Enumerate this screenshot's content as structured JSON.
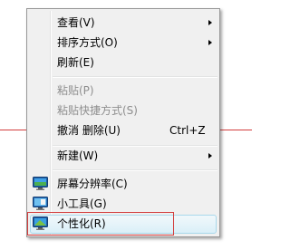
{
  "menu": {
    "view": {
      "label": "查看(V)",
      "has_submenu": true
    },
    "sort": {
      "label": "排序方式(O)",
      "has_submenu": true
    },
    "refresh": {
      "label": "刷新(E)"
    },
    "paste": {
      "label": "粘贴(P)",
      "disabled": true
    },
    "paste_shortcut": {
      "label": "粘贴快捷方式(S)",
      "disabled": true
    },
    "undo_delete": {
      "label": "撤消 删除(U)",
      "shortcut": "Ctrl+Z"
    },
    "new": {
      "label": "新建(W)",
      "has_submenu": true
    },
    "screen_resolution": {
      "label": "屏幕分辨率(C)",
      "icon": "monitor-icon"
    },
    "gadgets": {
      "label": "小工具(G)",
      "icon": "gadgets-icon"
    },
    "personalize": {
      "label": "个性化(R)",
      "icon": "personalize-icon",
      "hovered": true
    }
  },
  "colors": {
    "annotation": "#d23c3c",
    "menu_background": "#f0f0f0",
    "hover_border": "#a8d8eb"
  }
}
